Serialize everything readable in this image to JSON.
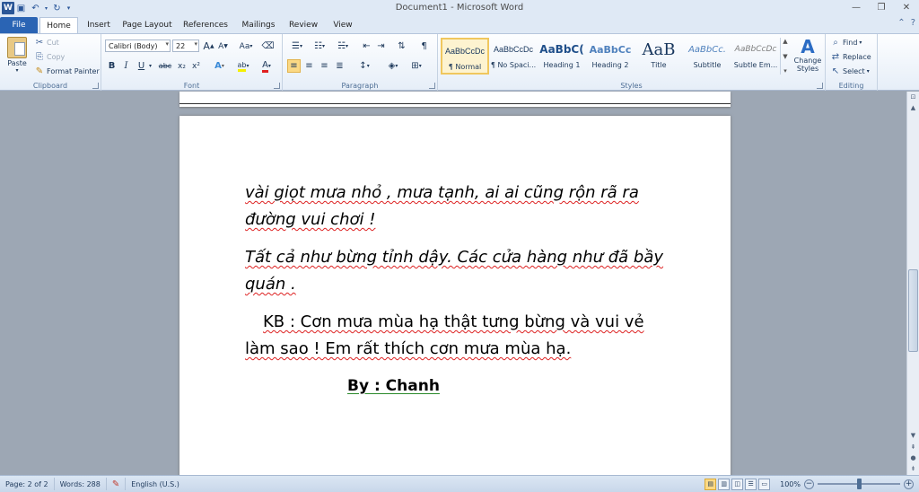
{
  "window": {
    "title": "Document1  -  Microsoft Word"
  },
  "qat": {
    "logo": "W",
    "save_icon": "save-icon",
    "undo_icon": "undo-icon",
    "redo_icon": "redo-icon"
  },
  "tabs": [
    "File",
    "Home",
    "Insert",
    "Page Layout",
    "References",
    "Mailings",
    "Review",
    "View"
  ],
  "clipboard": {
    "paste": "Paste",
    "cut": "Cut",
    "copy": "Copy",
    "format_painter": "Format Painter",
    "label": "Clipboard"
  },
  "font": {
    "name": "Calibri (Body)",
    "size": "22",
    "label": "Font",
    "bold": "B",
    "italic": "I",
    "underline": "U",
    "strike": "abc",
    "sub": "x₂",
    "sup": "x²",
    "grow": "A",
    "shrink": "A",
    "case": "Aa",
    "highlight": "ab",
    "color": "A",
    "effects": "A"
  },
  "paragraph": {
    "label": "Paragraph"
  },
  "styles": {
    "label": "Styles",
    "items": [
      {
        "sample": "AaBbCcDc",
        "name": "¶ Normal"
      },
      {
        "sample": "AaBbCcDc",
        "name": "¶ No Spaci..."
      },
      {
        "sample": "AaBbC(",
        "name": "Heading 1"
      },
      {
        "sample": "AaBbCc",
        "name": "Heading 2"
      },
      {
        "sample": "AaB",
        "name": "Title"
      },
      {
        "sample": "AaBbCc.",
        "name": "Subtitle"
      },
      {
        "sample": "AaBbCcDc",
        "name": "Subtle Em..."
      }
    ],
    "change_styles": "Change Styles"
  },
  "editing": {
    "find": "Find",
    "replace": "Replace",
    "select": "Select",
    "label": "Editing"
  },
  "document": {
    "p1_line1": "vài giọt mưa nhỏ , mưa tạnh, ai ai cũng rộn rã ra",
    "p1_line2": "đường vui chơi !",
    "p2_line1": "Tất cả như bừng tỉnh dậy. Các cửa hàng như đã bầy",
    "p2_line2": "quán .",
    "p3_line1": "KB : Cơn mưa mùa hạ thật tưng bừng và vui vẻ",
    "p3_line2": "làm sao ! Em rất thích cơn mưa mùa hạ.",
    "signature": "By : Chanh"
  },
  "status": {
    "page": "Page: 2 of 2",
    "words": "Words: 288",
    "language": "English (U.S.)",
    "zoom": "100%",
    "zoom_level": 0.5
  }
}
